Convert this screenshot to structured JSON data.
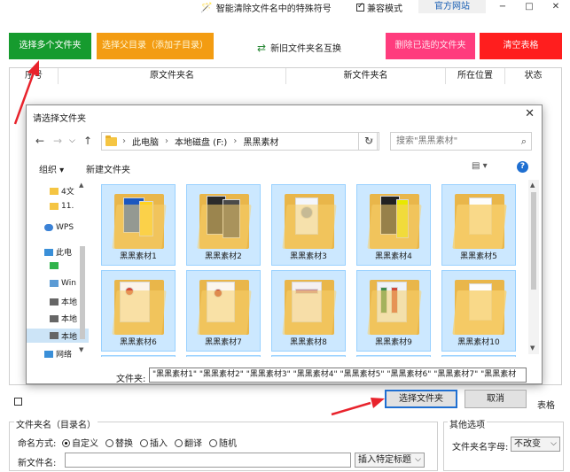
{
  "titlebar": {
    "hint": "智能清除文件名中的特殊符号",
    "compat_label": "兼容模式",
    "compat_checked": true,
    "site_label": "官方网站",
    "minimize": "−",
    "maximize": "□",
    "close": "✕"
  },
  "toolbar": {
    "select_multi": "选择多个文件夹",
    "select_parent": "选择父目录（添加子目录）",
    "swap": "新旧文件夹名互换",
    "delete_selected": "删除已选的文件夹",
    "clear_table": "清空表格"
  },
  "grid": {
    "columns": [
      "序号",
      "原文件夹名",
      "新文件夹名",
      "所在位置",
      "状态"
    ]
  },
  "bottom": {
    "right_fragment": "表格",
    "group_left_title": "文件夹名（目录名）",
    "naming_label": "命名方式:",
    "naming_options": [
      "自定义",
      "替换",
      "插入",
      "翻译",
      "随机"
    ],
    "naming_selected": "自定义",
    "newname_label": "新文件名:",
    "insert_label": "插入特定标题",
    "group_right_title": "其他选项",
    "fn_case_label": "文件夹名字母:",
    "fn_case_value": "不改变"
  },
  "dialog": {
    "title": "请选择文件夹",
    "close": "✕",
    "breadcrumb": [
      "此电脑",
      "本地磁盘 (F:)",
      "黑黑素材"
    ],
    "search_placeholder": "搜索\"黑黑素材\"",
    "organize": "组织 ▾",
    "new_folder": "新建文件夹",
    "nav_items": [
      "4文",
      "11.",
      "WPS",
      "此电",
      "",
      "Win",
      "本地",
      "本地",
      "本地",
      "网络"
    ],
    "folders": [
      "黑黑素材1",
      "黑黑素材2",
      "黑黑素材3",
      "黑黑素材4",
      "黑黑素材5",
      "黑黑素材6",
      "黑黑素材7",
      "黑黑素材8",
      "黑黑素材9",
      "黑黑素材10"
    ],
    "filename_label": "文件夹:",
    "filename_value": "\"黑黑素材1\" \"黑黑素材2\" \"黑黑素材3\" \"黑黑素材4\" \"黑黑素材5\" \"黑黑素材6\" \"黑黑素材7\" \"黑黑素材",
    "select_button": "选择文件夹",
    "cancel_button": "取消"
  },
  "colors": {
    "select_multi_bg": "#169b2e",
    "select_parent_bg": "#f39c12",
    "delete_bg": "#ff3c7d",
    "clear_bg": "#ff1e1e",
    "selection_bg": "#cce8ff",
    "arrow_red": "#e8232c"
  }
}
